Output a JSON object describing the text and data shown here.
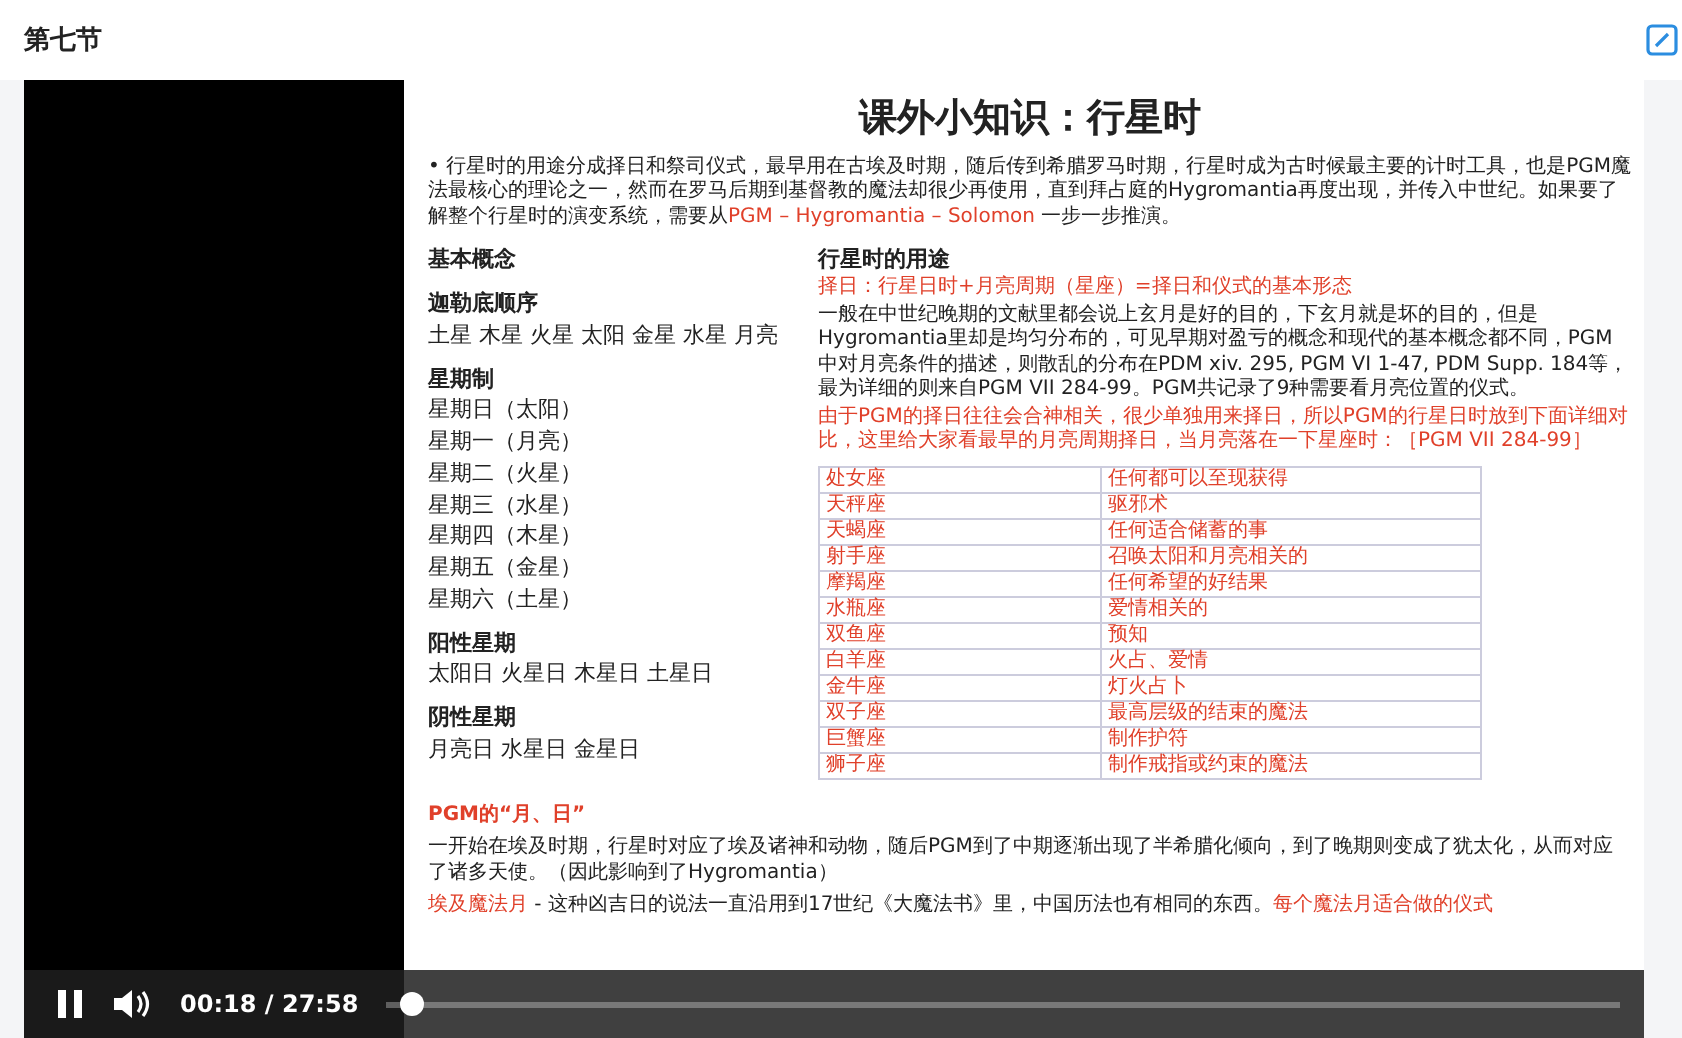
{
  "header": {
    "title": "第七节"
  },
  "slide": {
    "title": "课外小知识：行星时",
    "intro": [
      {
        "kind": "plain",
        "text": "行星时的用途分成择日和祭司仪式，最早用在古埃及时期，随后传到希腊罗马时期，行星时成为古时候最主要的计时工具，也是PGM魔法最核心的理论之一，然而在罗马后期到基督教的魔法却很少再使用，直到拜占庭的Hygromantia再度出现，并传入中世纪。如果要了解整个行星时的演变系统，需要从"
      },
      {
        "kind": "red",
        "text": "PGM – Hygromantia – Solomon"
      },
      {
        "kind": "plain",
        "text": " 一步一步推演。"
      }
    ],
    "bullet": "•",
    "left_sections": [
      {
        "heading": "基本概念"
      },
      {
        "heading": "迦勒底顺序",
        "lines": [
          "土星 木星 火星 太阳 金星 水星 月亮"
        ]
      },
      {
        "heading": "星期制",
        "lines": [
          "星期日（太阳）",
          "星期一（月亮）",
          "星期二（火星）",
          "星期三（水星）",
          "星期四（木星）",
          "星期五（金星）",
          "星期六（土星）"
        ]
      },
      {
        "heading": "阳性星期",
        "lines": [
          "太阳日 火星日 木星日 土星日"
        ]
      },
      {
        "heading": "阴性星期",
        "lines": [
          "月亮日 水星日 金星日"
        ]
      }
    ],
    "right": {
      "heading": "行星时的用途",
      "paragraphs": [
        {
          "kind": "red",
          "text": "择日：行星日时+月亮周期（星座）=择日和仪式的基本形态"
        },
        {
          "kind": "plain",
          "text": "一般在中世纪晚期的文献里都会说上玄月是好的目的，下玄月就是坏的目的，但是Hygromantia里却是均匀分布的，可见早期对盈亏的概念和现代的基本概念都不同，PGM中对月亮条件的描述，则散乱的分布在PDM xiv. 295, PGM VI 1-47, PDM Supp. 184等，最为详细的则来自PGM VII 284-99。PGM共记录了9种需要看月亮位置的仪式。"
        },
        {
          "kind": "red",
          "text": "由于PGM的择日往往会合神相关，很少单独用来择日，所以PGM的行星日时放到下面详细对比，这里给大家看最早的月亮周期择日，当月亮落在一下星座时：［PGM VII 284-99］"
        }
      ],
      "table": [
        [
          "处女座",
          "任何都可以至现获得"
        ],
        [
          "天秤座",
          "驱邪术"
        ],
        [
          "天蝎座",
          "任何适合储蓄的事"
        ],
        [
          "射手座",
          "召唤太阳和月亮相关的"
        ],
        [
          "摩羯座",
          "任何希望的好结果"
        ],
        [
          "水瓶座",
          "爱情相关的"
        ],
        [
          "双鱼座",
          "预知"
        ],
        [
          "白羊座",
          "火占、爱情"
        ],
        [
          "金牛座",
          "灯火占卜"
        ],
        [
          "双子座",
          "最高层级的结束的魔法"
        ],
        [
          "巨蟹座",
          "制作护符"
        ],
        [
          "狮子座",
          "制作戒指或约束的魔法"
        ]
      ]
    },
    "pgm_heading": "PGM的“月、日”",
    "pgm_text": "一开始在埃及时期，行星时对应了埃及诸神和动物，随后PGM到了中期逐渐出现了半希腊化倾向，到了晚期则变成了犹太化，从而对应了诸多天使。（因此影响到了Hygromantia）",
    "bottom": [
      {
        "kind": "red",
        "text": "埃及魔法月"
      },
      {
        "kind": "plain",
        "text": " - 这种凶吉日的说法一直沿用到17世纪《大魔法书》里，中国历法也有相同的东西。"
      },
      {
        "kind": "red",
        "text": "每个魔法月适合做的仪式"
      }
    ]
  },
  "player": {
    "playing": true,
    "current": "00:18",
    "separator": "/",
    "duration": "27:58",
    "level": 0.011
  }
}
